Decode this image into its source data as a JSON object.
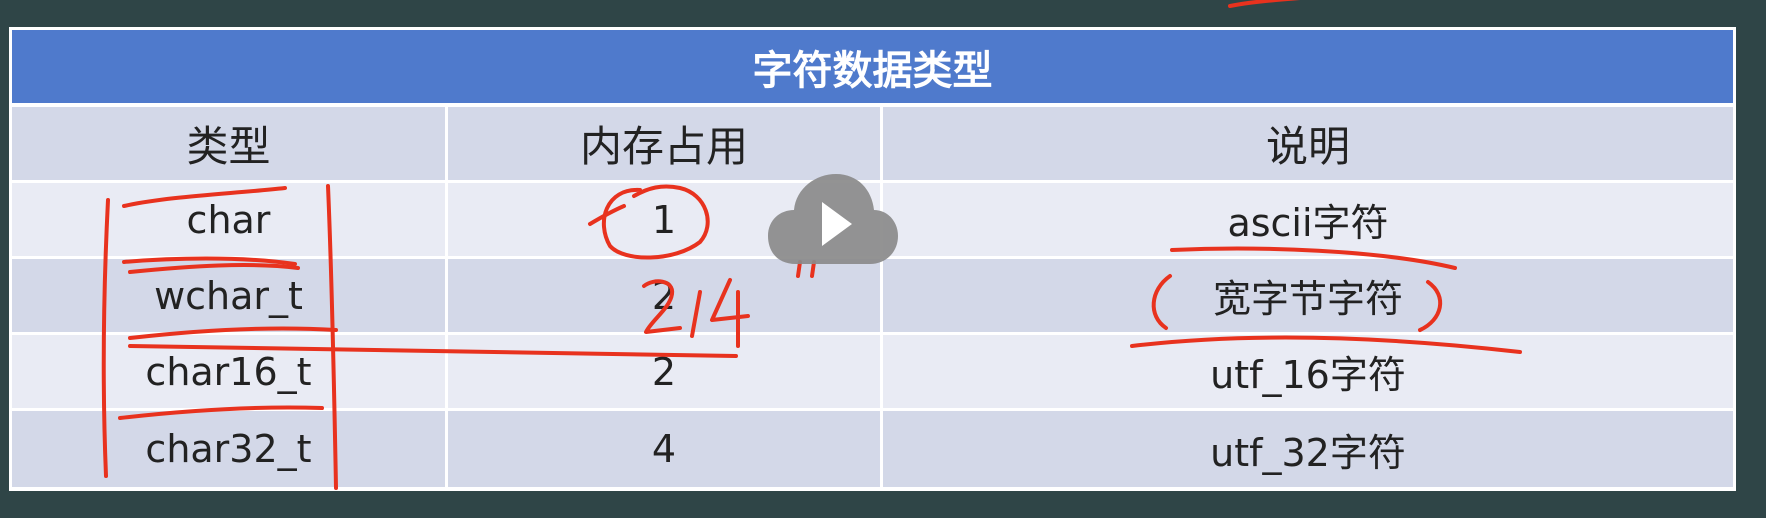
{
  "table": {
    "title": "字符数据类型",
    "headers": [
      "类型",
      "内存占用",
      "说明"
    ],
    "rows": [
      {
        "type": "char",
        "size": "1",
        "desc": "ascii字符"
      },
      {
        "type": "wchar_t",
        "size": "2",
        "desc": "宽字节字符"
      },
      {
        "type": "char16_t",
        "size": "2",
        "desc": "utf_16字符"
      },
      {
        "type": "char32_t",
        "size": "4",
        "desc": "utf_32字符"
      }
    ]
  },
  "annotations": {
    "handwritten_note": "2/4",
    "ink_color": "#e8321e"
  },
  "player": {
    "icon": "play-icon",
    "button_color": "#8a8a8a"
  }
}
